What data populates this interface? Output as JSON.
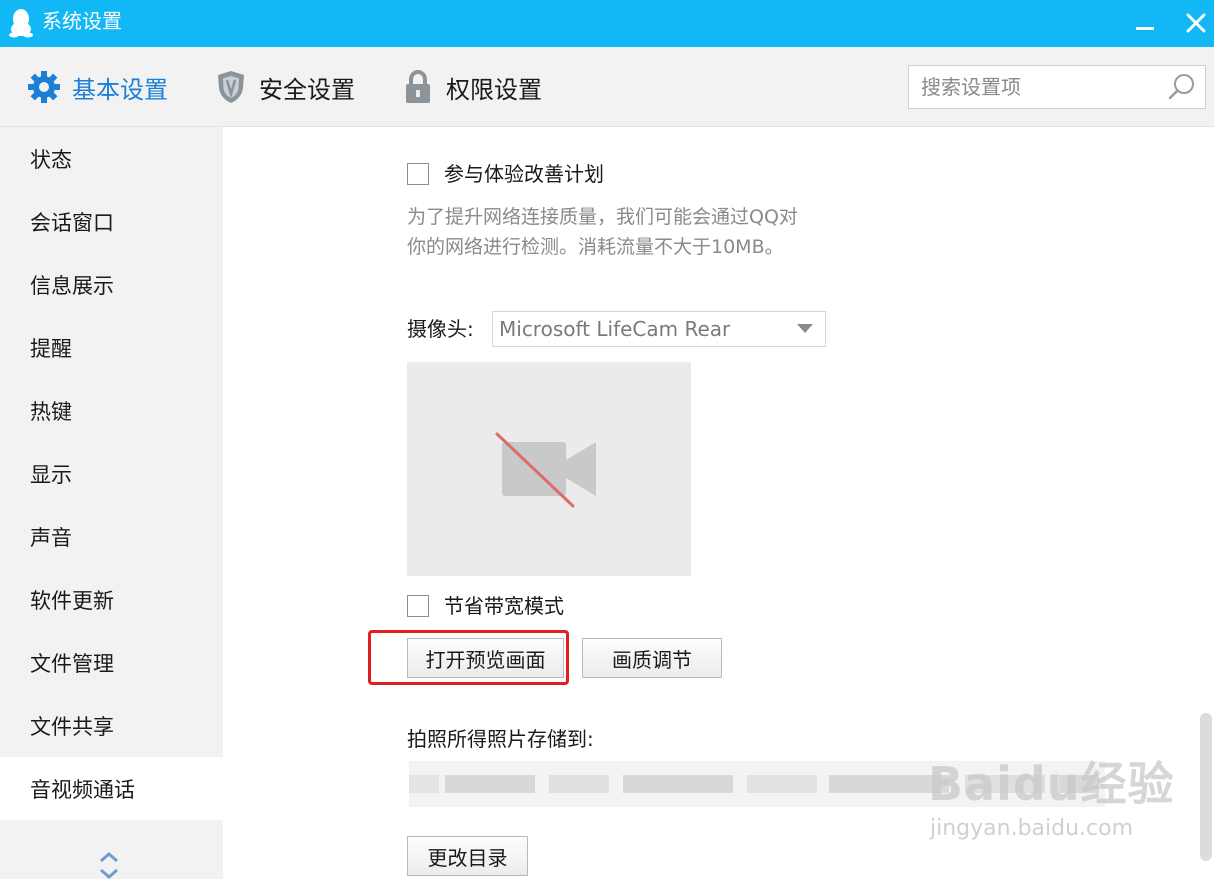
{
  "window": {
    "title": "系统设置"
  },
  "tabs": [
    {
      "label": "基本设置",
      "active": true,
      "icon": "gear-icon"
    },
    {
      "label": "安全设置",
      "active": false,
      "icon": "shield-icon"
    },
    {
      "label": "权限设置",
      "active": false,
      "icon": "lock-icon"
    }
  ],
  "search": {
    "placeholder": "搜索设置项"
  },
  "sidebar": {
    "items": [
      {
        "label": "状态"
      },
      {
        "label": "会话窗口"
      },
      {
        "label": "信息展示"
      },
      {
        "label": "提醒"
      },
      {
        "label": "热键"
      },
      {
        "label": "显示"
      },
      {
        "label": "声音"
      },
      {
        "label": "软件更新"
      },
      {
        "label": "文件管理"
      },
      {
        "label": "文件共享"
      },
      {
        "label": "音视频通话",
        "active": true
      }
    ]
  },
  "main": {
    "experience": {
      "label": "参与体验改善计划",
      "checked": false,
      "hint_line1": "为了提升网络连接质量，我们可能会通过QQ对",
      "hint_line2": "你的网络进行检测。消耗流量不大于10MB。"
    },
    "camera": {
      "label": "摄像头:",
      "selected": "Microsoft LifeCam Rear"
    },
    "bandwidth": {
      "label": "节省带宽模式",
      "checked": false
    },
    "buttons": {
      "open_preview": "打开预览画面",
      "quality": "画质调节",
      "change_dir": "更改目录"
    },
    "save_path": {
      "label": "拍照所得照片存储到:"
    }
  },
  "watermark": {
    "logo": "Baidu经验",
    "url": "jingyan.baidu.com"
  },
  "colors": {
    "titlebar": "#12b7f5",
    "accent": "#1b7fd8",
    "highlight": "#e02020"
  }
}
